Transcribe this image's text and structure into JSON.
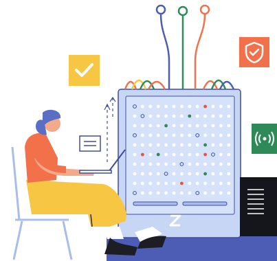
{
  "illustration": {
    "colors": {
      "outline": "#3d4d9e",
      "server_body": "#c7d6f5",
      "server_side": "#a9bdeb",
      "server_dot": "#ffffff",
      "dot_red": "#e8553c",
      "dot_green": "#2e8b57",
      "badge_yellow": "#f7c744",
      "badge_orange": "#f2714b",
      "badge_green": "#2e8b57",
      "dark_panel": "#15161c",
      "desk": "#4d5db5",
      "shirt": "#f2714b",
      "pants": "#f7c744",
      "hair": "#5a6fc4",
      "skin": "#f4a98a",
      "cable_orange": "#f2714b",
      "cable_green": "#2e8b57",
      "cable_blue": "#4d5db5"
    },
    "icons": [
      "check-icon",
      "shield-check-icon",
      "wifi-signal-icon",
      "email-icon",
      "logo-icon"
    ]
  }
}
